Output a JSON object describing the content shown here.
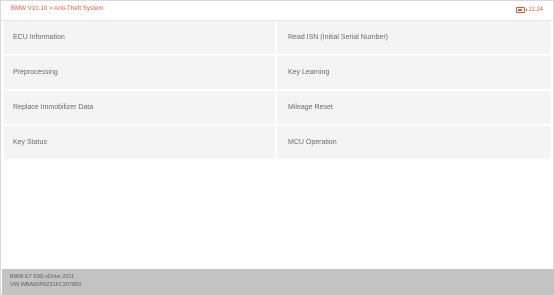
{
  "header": {
    "title": "BMW V10.10 > Anti-Theft System",
    "time": "11:24"
  },
  "menu": {
    "items": [
      {
        "label": "ECU Information"
      },
      {
        "label": "Read ISN (Initial Serial Number)"
      },
      {
        "label": "Preprocessing"
      },
      {
        "label": "Key Learning"
      },
      {
        "label": "Replace Immobilizer Data"
      },
      {
        "label": "Mileage Reset"
      },
      {
        "label": "Key Status"
      },
      {
        "label": "MCU Operation"
      }
    ]
  },
  "footer": {
    "vehicle": "BMW E7 530i sDrive 2011",
    "vin": "VIN WBA00P0Z31FC207850"
  }
}
